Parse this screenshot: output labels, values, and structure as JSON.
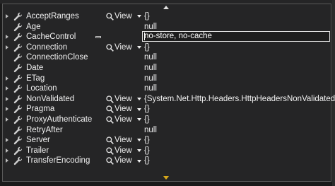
{
  "viewer_label": "View",
  "editing_value": "no-store, no-cache",
  "rows": [
    {
      "name": "AcceptRanges",
      "expandable": true,
      "viewer": true,
      "value": "{}"
    },
    {
      "name": "Age",
      "expandable": false,
      "viewer": false,
      "value": "null"
    },
    {
      "name": "CacheControl",
      "expandable": true,
      "viewer": false,
      "value": "",
      "editing": true
    },
    {
      "name": "Connection",
      "expandable": true,
      "viewer": true,
      "value": "{}"
    },
    {
      "name": "ConnectionClose",
      "expandable": false,
      "viewer": false,
      "value": "null"
    },
    {
      "name": "Date",
      "expandable": false,
      "viewer": false,
      "value": "null"
    },
    {
      "name": "ETag",
      "expandable": true,
      "viewer": false,
      "value": "null"
    },
    {
      "name": "Location",
      "expandable": true,
      "viewer": false,
      "value": "null"
    },
    {
      "name": "NonValidated",
      "expandable": true,
      "viewer": true,
      "value": "{System.Net.Http.Headers.HttpHeadersNonValidated}"
    },
    {
      "name": "Pragma",
      "expandable": true,
      "viewer": true,
      "value": "{}"
    },
    {
      "name": "ProxyAuthenticate",
      "expandable": true,
      "viewer": true,
      "value": "{}"
    },
    {
      "name": "RetryAfter",
      "expandable": false,
      "viewer": false,
      "value": "null"
    },
    {
      "name": "Server",
      "expandable": true,
      "viewer": true,
      "value": "{}"
    },
    {
      "name": "Trailer",
      "expandable": true,
      "viewer": true,
      "value": "{}"
    },
    {
      "name": "TransferEncoding",
      "expandable": true,
      "viewer": true,
      "value": "{}"
    }
  ],
  "icons": {
    "property": "wrench-icon",
    "viewer": "magnifier-icon",
    "expand": "expand-triangle-icon",
    "pin": "pin-icon",
    "scroll_up": "scroll-up-arrow-icon",
    "scroll_down": "scroll-down-arrow-icon"
  },
  "colors": {
    "background": "#252526",
    "border": "#5a5a5a",
    "text": "#f1f1f1",
    "scroll_down_accent": "#d7a81a"
  }
}
